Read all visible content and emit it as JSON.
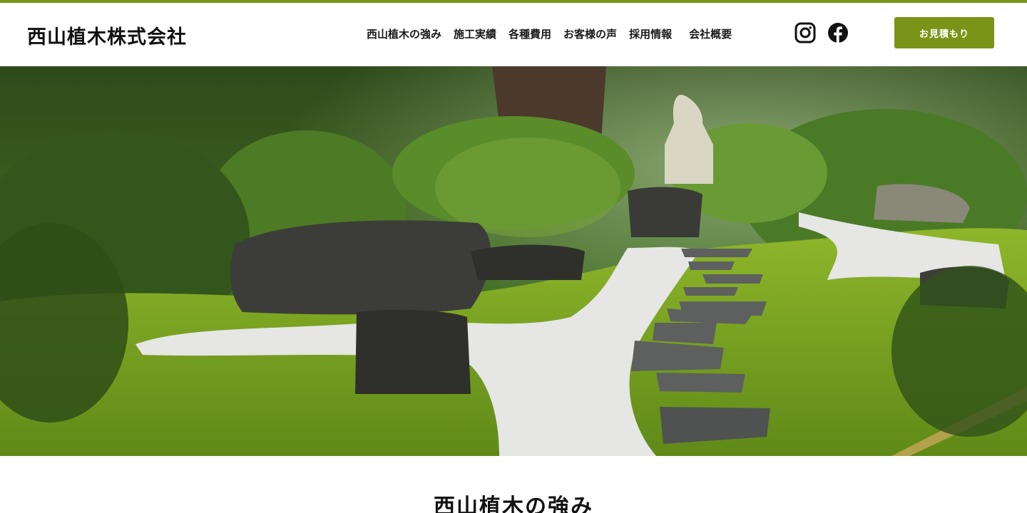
{
  "header": {
    "logo_text": "西山植木株式会社",
    "nav": [
      {
        "label": "西山植木の強み"
      },
      {
        "label": "施工実績"
      },
      {
        "label": "各種費用"
      },
      {
        "label": "お客様の声"
      },
      {
        "label": "採用情報"
      },
      {
        "label": "会社概要"
      }
    ],
    "social": [
      "instagram-icon",
      "facebook-icon"
    ],
    "cta_label": "お見積もり"
  },
  "hero": {
    "image": "japanese-garden-photo"
  },
  "section": {
    "title": "西山植木の強み"
  },
  "colors": {
    "accent": "#7a9418",
    "text": "#1a1a1a",
    "background": "#ffffff"
  }
}
